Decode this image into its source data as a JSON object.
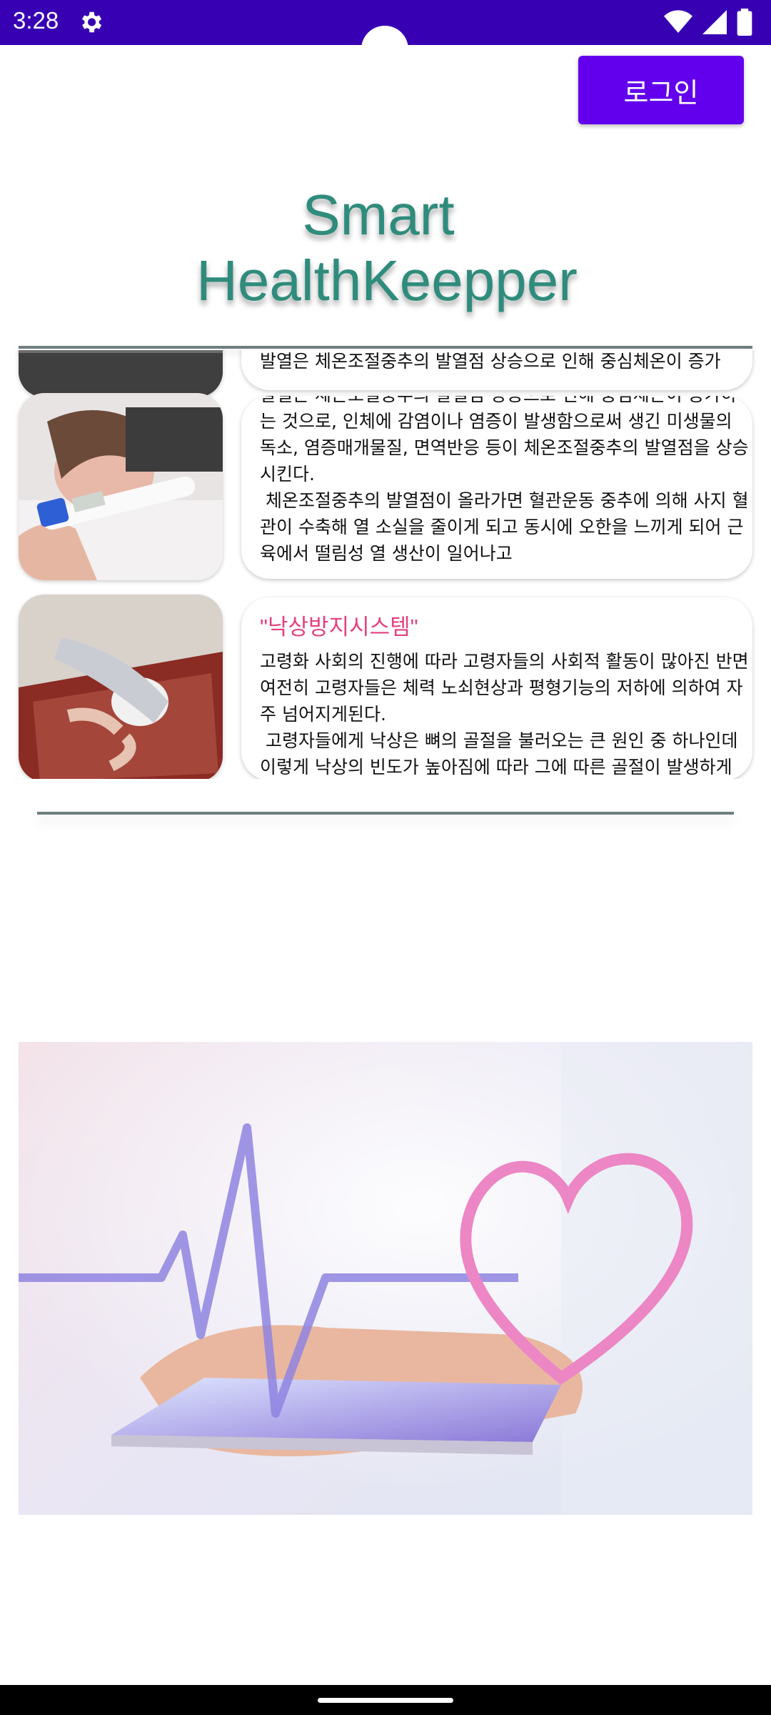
{
  "status": {
    "time": "3:28"
  },
  "header": {
    "login_label": "로그인",
    "title_line1": "Smart",
    "title_line2": "HealthKeepper"
  },
  "items": [
    {
      "title": "",
      "body": "…이하도 하지… 자세에 부합한 자극으로 신체의 체열 신호를 유지\n발열은 체온조절중추의 발열점 상승으로 인해 중심체온이 증가"
    },
    {
      "title": "",
      "body": "발열은 체온조절중추의 발열점 상승으로 인해 중심체온이 증가하는 것으로, 인체에 감염이나 염증이 발생함으로써 생긴 미생물의 독소, 염증매개물질, 면역반응 등이 체온조절중추의 발열점을 상승시킨다.\n 체온조절중추의 발열점이 올라가면 혈관운동 중추에 의해 사지 혈관이 수축해 열 소실을 줄이게 되고 동시에 오한을 느끼게 되어 근육에서 떨림성 열 생산이 일어나고"
    },
    {
      "title": "\"낙상방지시스템\"",
      "body": "고령화 사회의 진행에 따라 고령자들의 사회적 활동이 많아진 반면 여전히 고령자들은 체력 노쇠현상과 평형기능의 저하에 의하여 자주 넘어지게된다.\n 고령자들에게 낙상은 뼈의 골절을 불러오는 큰 원인 중 하나인데 이렇게 낙상의 빈도가 높아짐에 따라 그에 따른 골절이 발생하게 되고 경우에 따라 합병증이 생기게 된다"
    }
  ],
  "colors": {
    "status_bar": "#3700b3",
    "login_button": "#6200ee",
    "title": "#2f8c7c",
    "item_title": "#e4417f"
  }
}
